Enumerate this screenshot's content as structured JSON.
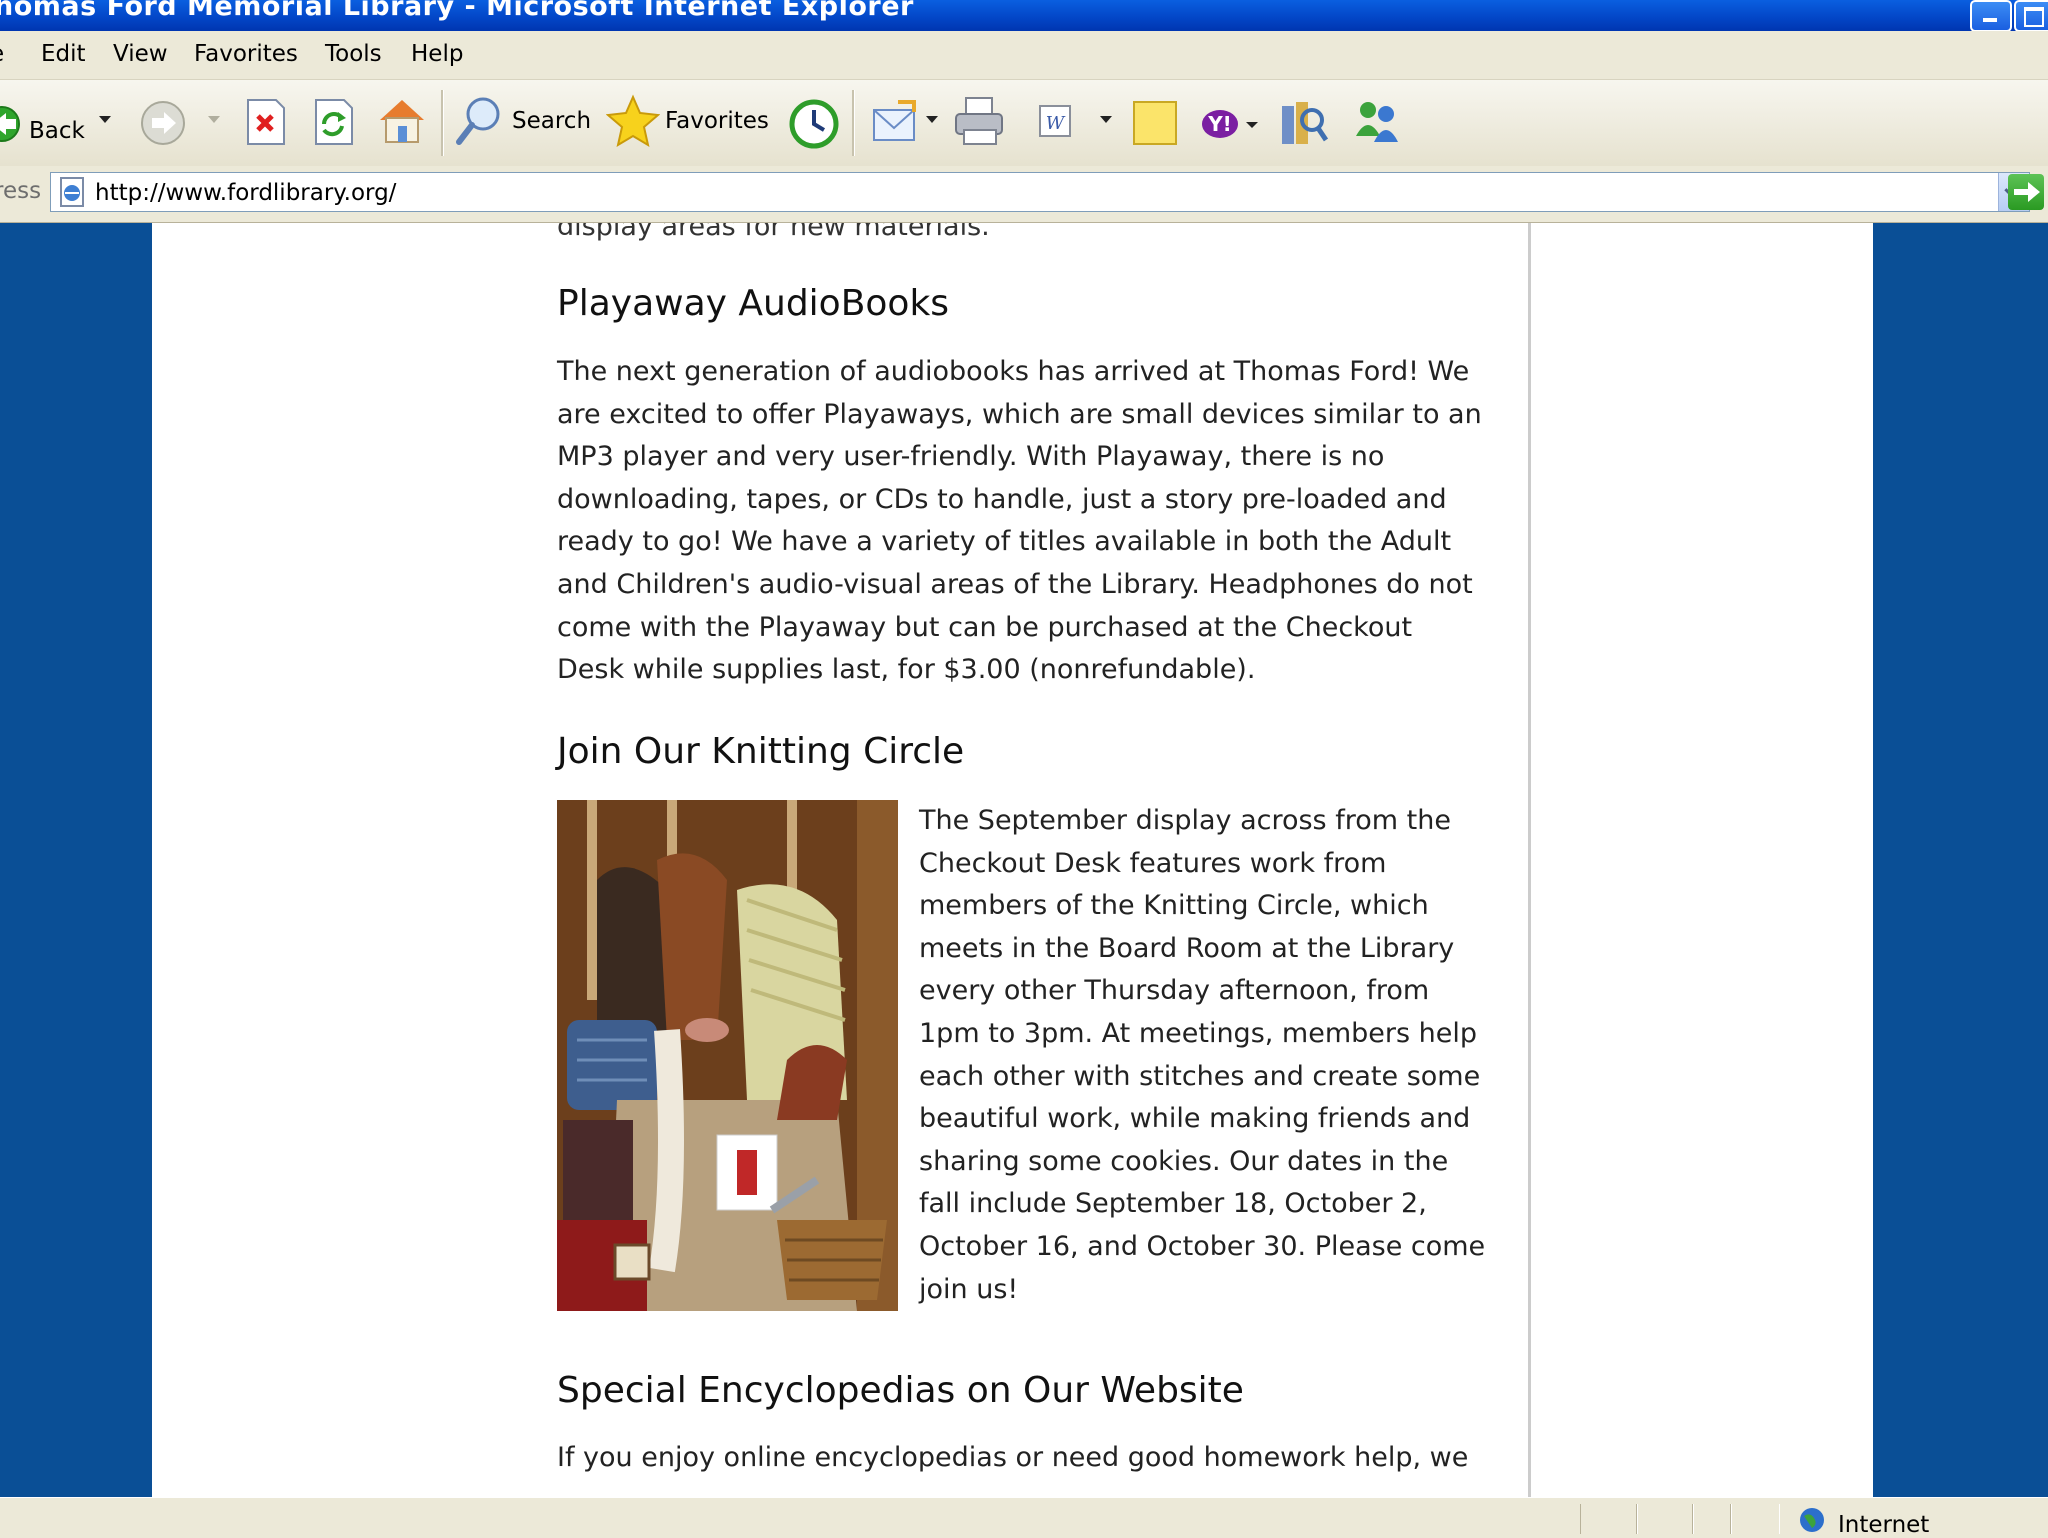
{
  "window": {
    "title": "homas Ford Memorial Library - Microsoft Internet Explorer"
  },
  "menu": {
    "file": "e",
    "edit": "Edit",
    "view": "View",
    "favorites": "Favorites",
    "tools": "Tools",
    "help": "Help"
  },
  "toolbar": {
    "back_label": "Back",
    "search_label": "Search",
    "favorites_label": "Favorites"
  },
  "address": {
    "label": "ress",
    "url": "http://www.fordlibrary.org/"
  },
  "content": {
    "clipped_line": "display areas for new materials.",
    "playaway": {
      "heading": "Playaway AudioBooks",
      "text": "The next generation of audiobooks has arrived at Thomas Ford! We are excited to offer Playaways, which are small devices similar to an MP3 player and very user-friendly. With Playaway, there is no downloading, tapes, or CDs to handle, just a story pre-loaded and ready to go! We have a variety of titles available in both the Adult and Children's audio-visual areas of the Library. Headphones do not come with the Playaway but can be purchased at the Checkout Desk while supplies last, for $3.00 (nonrefundable)."
    },
    "knitting": {
      "heading": "Join Our Knitting Circle",
      "text": "The September display across from the Checkout Desk features work from members of the Knitting Circle, which meets in the Board Room at the Library every other Thursday afternoon, from 1pm to 3pm. At meetings, members help each other with stitches and create some beautiful work, while making friends and sharing some cookies. Our dates in the fall include September 18, October 2, October 16, and October 30. Please come join us!"
    },
    "encyclopedias": {
      "heading": "Special Encyclopedias on Our Website",
      "text": "If you enjoy online encyclopedias or need good homework help, we"
    }
  },
  "status": {
    "zone": "Internet"
  },
  "colors": {
    "titlebar": "#0347C8",
    "page_background": "#0A4F96",
    "chrome": "#ECE9D8"
  }
}
